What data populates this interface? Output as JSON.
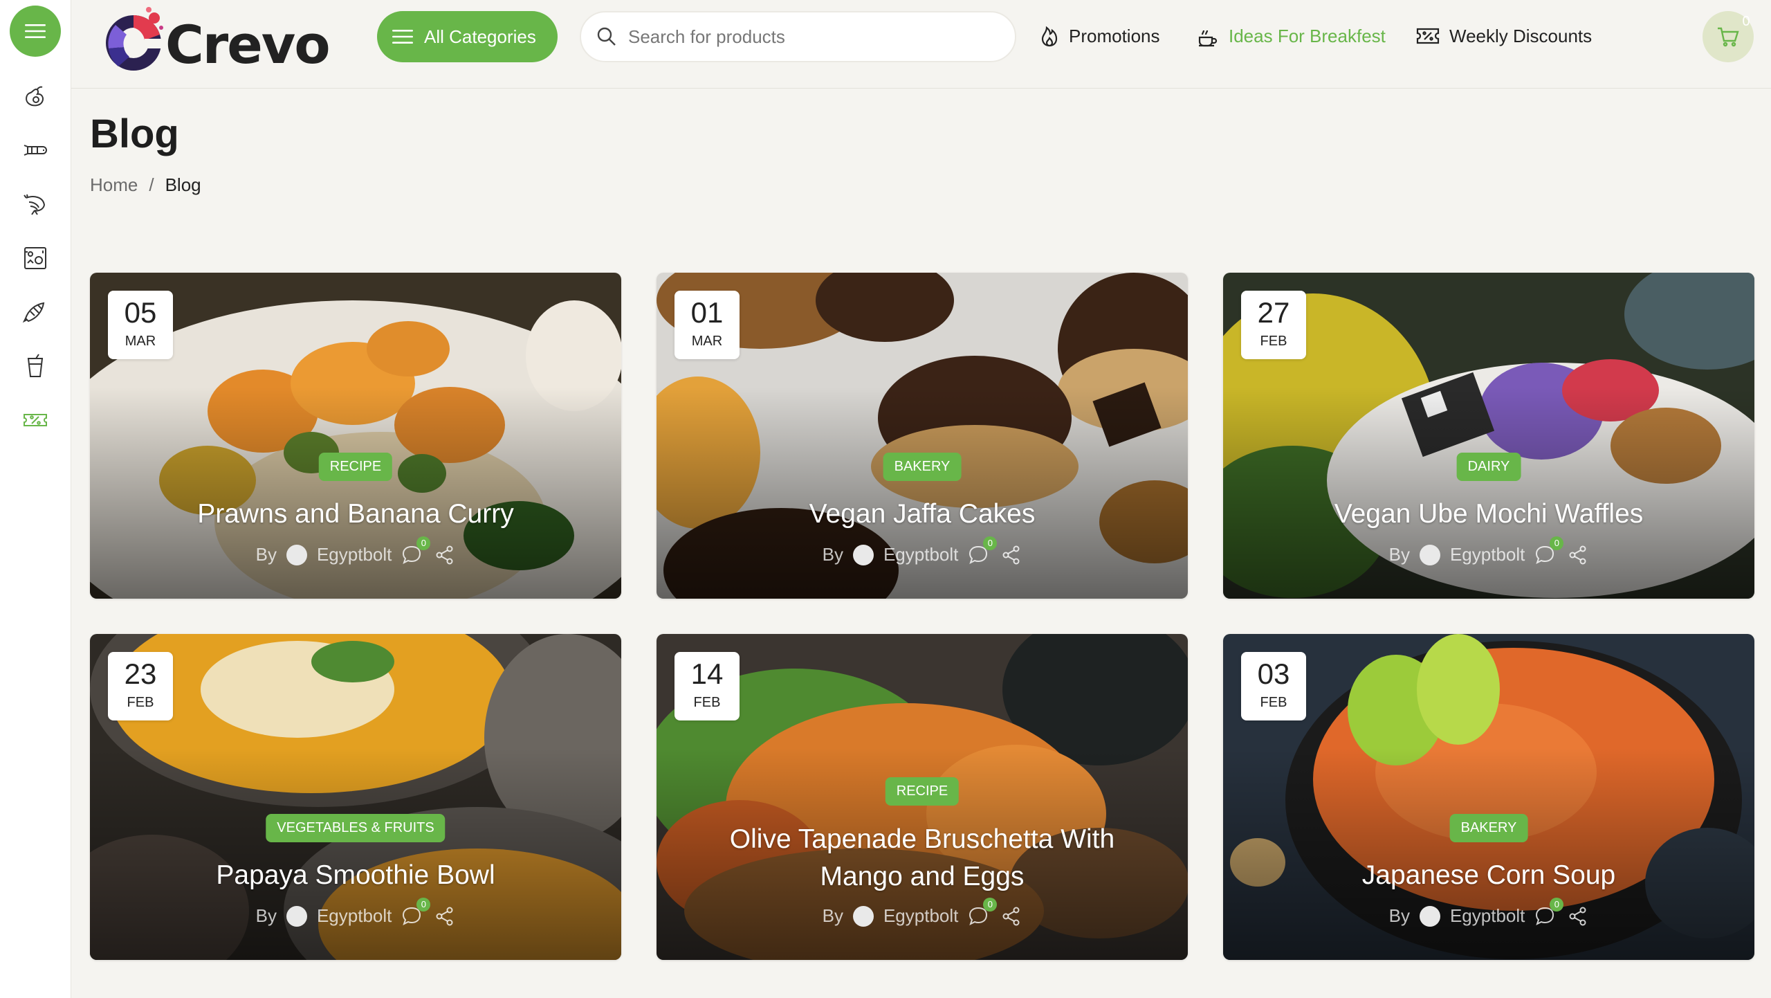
{
  "brand": {
    "name": "Crevo"
  },
  "header": {
    "categories_label": "All Categories",
    "search_placeholder": "Search for products",
    "nav": [
      {
        "label": "Promotions",
        "icon": "flame-icon"
      },
      {
        "label": "Ideas For Breakfest",
        "icon": "breakfast-icon",
        "active": true
      },
      {
        "label": "Weekly Discounts",
        "icon": "discount-ticket-icon"
      }
    ],
    "cart_count": "0"
  },
  "sidebar": {
    "items": [
      {
        "icon": "avocado-icon"
      },
      {
        "icon": "sausage-icon"
      },
      {
        "icon": "shrimp-icon"
      },
      {
        "icon": "frozen-food-icon"
      },
      {
        "icon": "croissant-icon"
      },
      {
        "icon": "drink-cup-icon"
      },
      {
        "icon": "discount-ticket-icon"
      }
    ]
  },
  "page": {
    "title": "Blog",
    "breadcrumb": [
      {
        "label": "Home"
      },
      {
        "label": "/"
      },
      {
        "label": "Blog"
      }
    ]
  },
  "posts": [
    {
      "day": "05",
      "month": "MAR",
      "category": "RECIPE",
      "title": "Prawns and Banana Curry",
      "by": "By",
      "author": "Egyptbolt",
      "comments": "0"
    },
    {
      "day": "01",
      "month": "MAR",
      "category": "BAKERY",
      "title": "Vegan Jaffa Cakes",
      "by": "By",
      "author": "Egyptbolt",
      "comments": "0"
    },
    {
      "day": "27",
      "month": "FEB",
      "category": "DAIRY",
      "title": "Vegan Ube Mochi Waffles",
      "by": "By",
      "author": "Egyptbolt",
      "comments": "0"
    },
    {
      "day": "23",
      "month": "FEB",
      "category": "VEGETABLES & FRUITS",
      "title": "Papaya Smoothie Bowl",
      "by": "By",
      "author": "Egyptbolt",
      "comments": "0"
    },
    {
      "day": "14",
      "month": "FEB",
      "category": "RECIPE",
      "title_line1": "Olive Tapenade Bruschetta With",
      "title_line2": "Mango and Eggs",
      "by": "By",
      "author": "Egyptbolt",
      "comments": "0"
    },
    {
      "day": "03",
      "month": "FEB",
      "category": "BAKERY",
      "title": "Japanese Corn Soup",
      "by": "By",
      "author": "Egyptbolt",
      "comments": "0"
    }
  ],
  "colors": {
    "accent": "#68b649",
    "background": "#f5f4f0",
    "cart_bg": "#e0e6c9"
  }
}
